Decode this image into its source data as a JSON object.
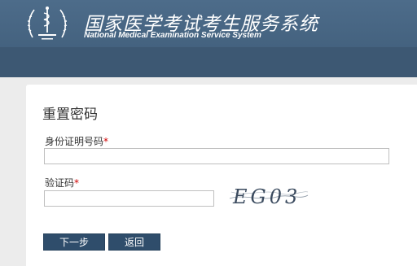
{
  "header": {
    "title_cn": "国家医学考试考生服务系统",
    "title_en": "National Medical Examination Service System",
    "logo_icon": "medical-exam-emblem-icon"
  },
  "form": {
    "title": "重置密码",
    "id_label": "身份证明号码",
    "id_value": "",
    "code_label": "验证码",
    "code_value": "",
    "required_mark": "*",
    "captcha_text": "EG03"
  },
  "buttons": {
    "next": "下一步",
    "back": "返回"
  },
  "colors": {
    "header": "#4d6c8a",
    "subbar": "#3d5873",
    "button": "#2f4d6b",
    "required": "#d00000"
  }
}
